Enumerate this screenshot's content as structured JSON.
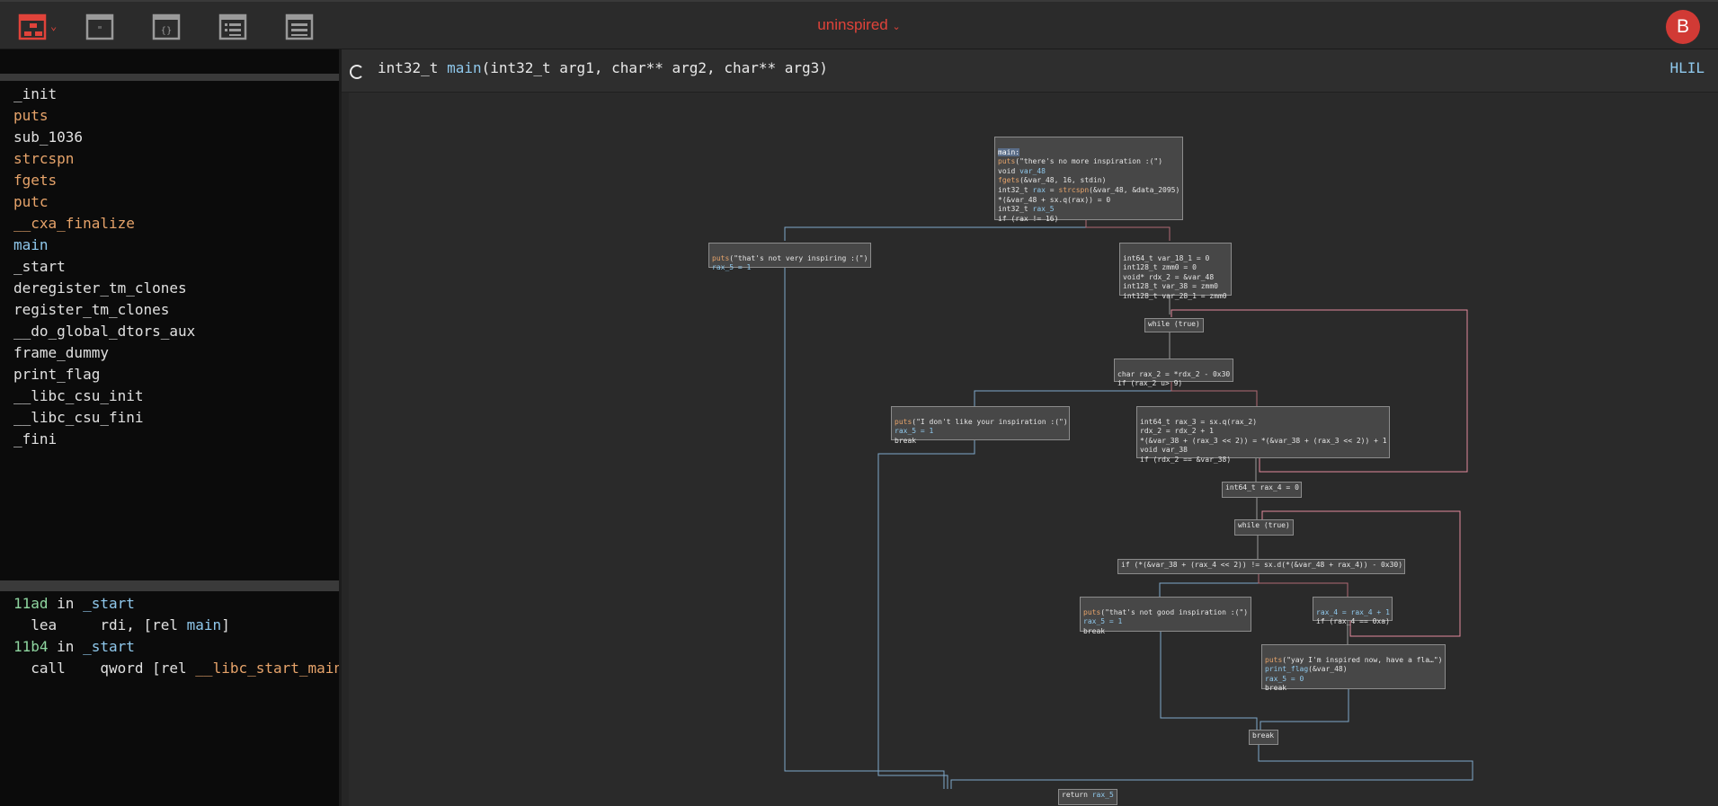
{
  "topbar": {
    "project_name": "uninspired",
    "avatar_letter": "B",
    "icons": [
      "graph-view-icon",
      "strings-icon",
      "types-icon",
      "symbols-icon",
      "log-icon"
    ],
    "accent_color": "#e0433a"
  },
  "symbols": [
    {
      "name": "_init",
      "kind": "function"
    },
    {
      "name": "puts",
      "kind": "import"
    },
    {
      "name": "sub_1036",
      "kind": "function"
    },
    {
      "name": "strcspn",
      "kind": "import"
    },
    {
      "name": "fgets",
      "kind": "import"
    },
    {
      "name": "putc",
      "kind": "import"
    },
    {
      "name": "__cxa_finalize",
      "kind": "import"
    },
    {
      "name": "main",
      "kind": "selected"
    },
    {
      "name": "_start",
      "kind": "function"
    },
    {
      "name": "deregister_tm_clones",
      "kind": "function"
    },
    {
      "name": "register_tm_clones",
      "kind": "function"
    },
    {
      "name": "__do_global_dtors_aux",
      "kind": "function"
    },
    {
      "name": "frame_dummy",
      "kind": "function"
    },
    {
      "name": "print_flag",
      "kind": "function"
    },
    {
      "name": "__libc_csu_init",
      "kind": "function"
    },
    {
      "name": "__libc_csu_fini",
      "kind": "function"
    },
    {
      "name": "_fini",
      "kind": "function"
    }
  ],
  "xrefs": {
    "r1_addr": "11ad",
    "r1_in": " in ",
    "r1_fn": "_start",
    "r2_op": "  lea     rdi, [rel ",
    "r2_ref": "main",
    "r2_end": "]",
    "r3_addr": "11b4",
    "r3_in": " in ",
    "r3_fn": "_start",
    "r4_op": "  call    qword [rel ",
    "r4_ref": "__libc_start_main"
  },
  "header": {
    "sig_ret": "int32_t ",
    "sig_fn": "main",
    "sig_args": "(int32_t arg1, char** arg2, char** arg3)",
    "view_mode": "HLIL"
  },
  "graph": {
    "n_main_hd": "main:",
    "n_main_l1a": "puts",
    "n_main_l1b": "(\"there's no more inspiration :(\")",
    "n_main_l2a": "void ",
    "n_main_l2b": "var_48",
    "n_main_l3a": "fgets",
    "n_main_l3b": "(&var_48, 16, stdin)",
    "n_main_l4a": "int32_t ",
    "n_main_l4b": "rax",
    "n_main_l4c": " = ",
    "n_main_l4d": "strcspn",
    "n_main_l4e": "(&var_48, &data_2095)",
    "n_main_l5": "*(&var_48 + sx.q(rax)) = 0",
    "n_main_l6a": "int32_t ",
    "n_main_l6b": "rax_5",
    "n_main_l7": "if (rax != 16)",
    "n_nvi_l1a": "puts",
    "n_nvi_l1b": "(\"that's not very inspiring :(\")",
    "n_nvi_l2": "rax_5 = 1",
    "n_init_l1": "int64_t var_18_1 = 0",
    "n_init_l2": "int128_t zmm0 = 0",
    "n_init_l3": "void* rdx_2 = &var_48",
    "n_init_l4": "int128_t var_38 = zmm0",
    "n_init_l5": "int128_t var_28_1 = zmm0",
    "n_w1": "while (true)",
    "n_char_l1": "char rax_2 = *rdx_2 - 0x30",
    "n_char_l2": "if (rax_2 u> 9)",
    "n_dl_l1a": "puts",
    "n_dl_l1b": "(\"I don't like your inspiration :(\")",
    "n_dl_l2": "rax_5 = 1",
    "n_dl_l3": "break",
    "n_loop_l1": "int64_t rax_3 = sx.q(rax_2)",
    "n_loop_l2": "rdx_2 = rdx_2 + 1",
    "n_loop_l3": "*(&var_38 + (rax_3 << 2)) = *(&var_38 + (rax_3 << 2)) + 1",
    "n_loop_l4": "void var_38",
    "n_loop_l5": "if (rdx_2 == &var_38)",
    "n_r4": "int64_t rax_4 = 0",
    "n_w2": "while (true)",
    "n_cmp": "if (*(&var_38 + (rax_4 << 2)) != sx.d(*(&var_48 + rax_4)) - 0x30)",
    "n_ng_l1a": "puts",
    "n_ng_l1b": "(\"that's not good inspiration :(\")",
    "n_ng_l2": "rax_5 = 1",
    "n_ng_l3": "break",
    "n_inc_l1": "rax_4 = rax_4 + 1",
    "n_inc_l2": "if (rax_4 == 0xa)",
    "n_yay_l1a": "puts",
    "n_yay_l1b": "(\"yay I'm inspired now, have a fla…\")",
    "n_yay_l2a": "print_flag",
    "n_yay_l2b": "(&var_48)",
    "n_yay_l3": "rax_5 = 0",
    "n_yay_l4": "break",
    "n_brk": "break",
    "n_ret_a": "return ",
    "n_ret_b": "rax_5"
  },
  "colors": {
    "edge_true": "#7fa8c9",
    "edge_false": "#b06a74",
    "loop_back": "#e3899c"
  }
}
